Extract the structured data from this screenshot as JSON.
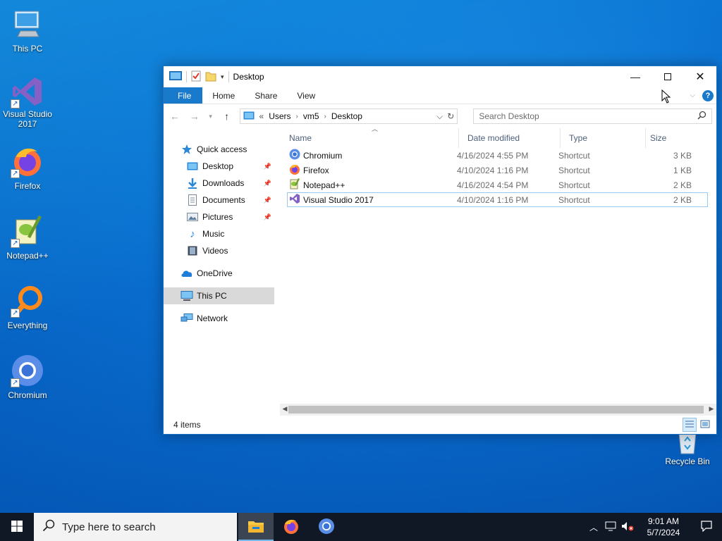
{
  "desktop": {
    "icons": [
      {
        "label": "This PC",
        "icon": "this-pc-icon"
      },
      {
        "label": "Visual Studio 2017",
        "icon": "visual-studio-icon"
      },
      {
        "label": "Firefox",
        "icon": "firefox-icon"
      },
      {
        "label": "Notepad++",
        "icon": "notepadpp-icon"
      },
      {
        "label": "Everything",
        "icon": "everything-icon"
      },
      {
        "label": "Chromium",
        "icon": "chromium-icon"
      }
    ],
    "recycle_bin": "Recycle Bin"
  },
  "window": {
    "title": "Desktop",
    "ribbon_tabs": [
      "File",
      "Home",
      "Share",
      "View"
    ],
    "address": {
      "prefix": "«",
      "crumbs": [
        "Users",
        "vm5",
        "Desktop"
      ]
    },
    "search_placeholder": "Search Desktop",
    "nav": {
      "quick_access": "Quick access",
      "pinned": [
        {
          "label": "Desktop",
          "pinned": true
        },
        {
          "label": "Downloads",
          "pinned": true
        },
        {
          "label": "Documents",
          "pinned": true
        },
        {
          "label": "Pictures",
          "pinned": true
        },
        {
          "label": "Music",
          "pinned": false
        },
        {
          "label": "Videos",
          "pinned": false
        }
      ],
      "onedrive": "OneDrive",
      "this_pc": "This PC",
      "network": "Network"
    },
    "columns": {
      "name": "Name",
      "date": "Date modified",
      "type": "Type",
      "size": "Size"
    },
    "files": [
      {
        "name": "Chromium",
        "date": "4/16/2024 4:55 PM",
        "type": "Shortcut",
        "size": "3 KB",
        "icon": "chromium-icon"
      },
      {
        "name": "Firefox",
        "date": "4/10/2024 1:16 PM",
        "type": "Shortcut",
        "size": "1 KB",
        "icon": "firefox-icon"
      },
      {
        "name": "Notepad++",
        "date": "4/16/2024 4:54 PM",
        "type": "Shortcut",
        "size": "2 KB",
        "icon": "notepadpp-icon"
      },
      {
        "name": "Visual Studio 2017",
        "date": "4/10/2024 1:16 PM",
        "type": "Shortcut",
        "size": "2 KB",
        "icon": "visual-studio-icon"
      }
    ],
    "status": "4 items"
  },
  "taskbar": {
    "search_placeholder": "Type here to search",
    "time": "9:01 AM",
    "date": "5/7/2024"
  },
  "colors": {
    "accent": "#1979ca",
    "taskbar": "#101826"
  }
}
